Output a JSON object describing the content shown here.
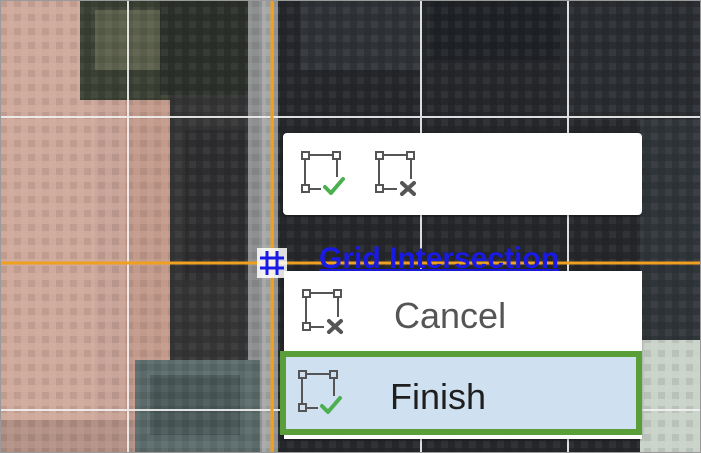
{
  "mini_toolbar": {
    "buttons": [
      {
        "name": "finish-button",
        "icon": "finish-icon"
      },
      {
        "name": "cancel-button",
        "icon": "cancel-icon"
      }
    ]
  },
  "snap_tip": {
    "icon": "grid-intersection-icon",
    "label": "Grid Intersection"
  },
  "context_menu": {
    "items": [
      {
        "label": "Cancel",
        "icon": "cancel-icon",
        "highlighted": false
      },
      {
        "label": "Finish",
        "icon": "finish-icon",
        "highlighted": true
      }
    ]
  },
  "colors": {
    "snap_line": "#f0a020",
    "snap_text": "#1a1ae6",
    "grid_line": "#f2f2f2",
    "check": "#4caf50",
    "highlight_fill": "#cfe0f0",
    "highlight_border": "#5a9e3a"
  }
}
